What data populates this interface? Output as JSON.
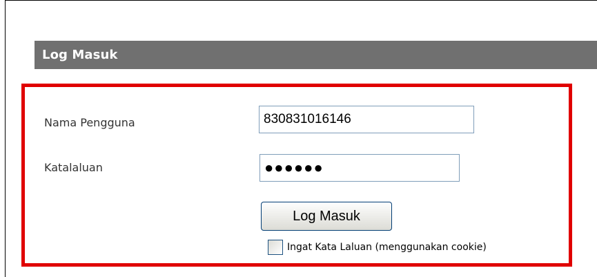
{
  "header": {
    "title": "Log Masuk"
  },
  "form": {
    "username_label": "Nama Pengguna",
    "username_value": "830831016146",
    "password_label": "Katalaluan",
    "password_masked": "●●●●●●",
    "submit_label": "Log Masuk",
    "remember_label": "Ingat Kata Laluan (menggunakan cookie)",
    "remember_checked": false
  },
  "colors": {
    "header_bg": "#707070",
    "highlight": "#e00000"
  }
}
